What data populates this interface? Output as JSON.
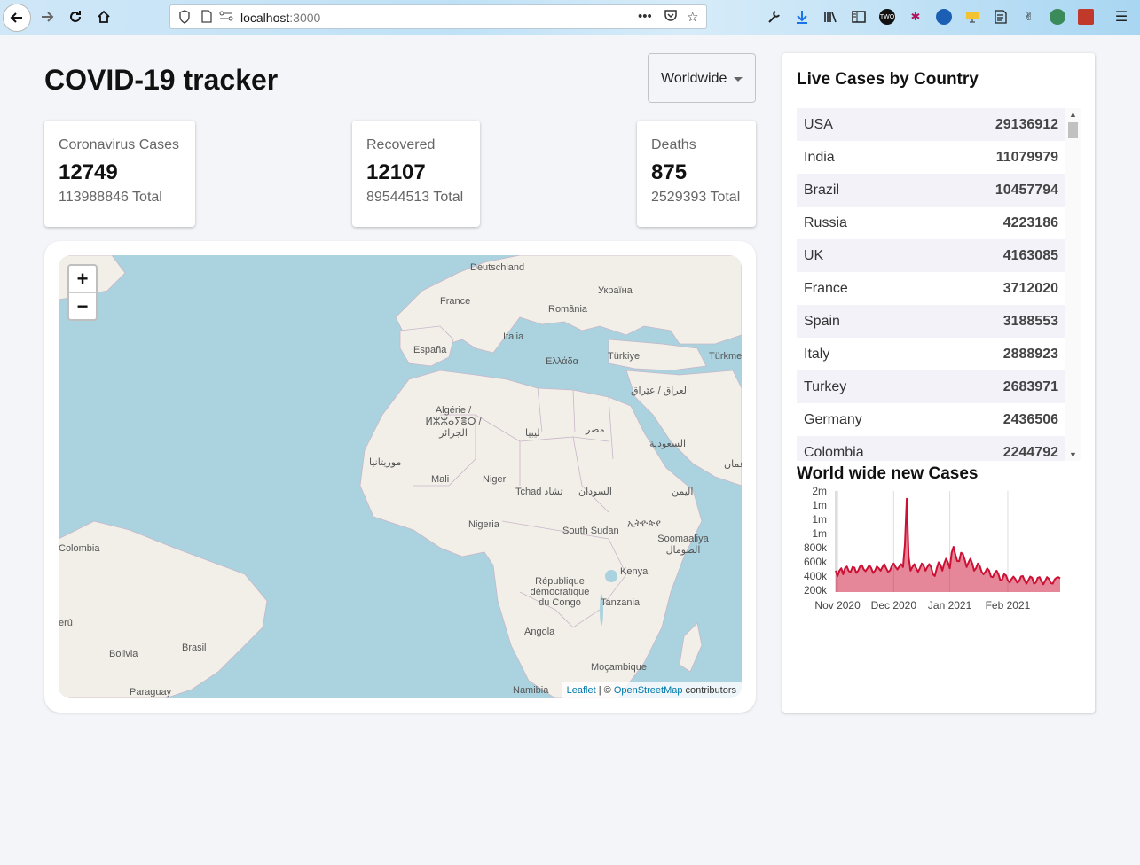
{
  "browser": {
    "url_host": "localhost",
    "url_port": ":3000",
    "extension_badge": "TWO"
  },
  "header": {
    "title": "COVID-19 tracker",
    "country_select": {
      "selected": "Worldwide"
    }
  },
  "stats": {
    "cases": {
      "label": "Coronavirus Cases",
      "today": "12749",
      "total": "113988846 Total"
    },
    "recovered": {
      "label": "Recovered",
      "today": "12107",
      "total": "89544513 Total"
    },
    "deaths": {
      "label": "Deaths",
      "today": "875",
      "total": "2529393 Total"
    }
  },
  "map": {
    "zoom_in": "+",
    "zoom_out": "−",
    "attribution": {
      "leaflet": "Leaflet",
      "sep": " | © ",
      "osm": "OpenStreetMap",
      "suffix": " contributors"
    },
    "labels": [
      "Deutschland",
      "France",
      "Україна",
      "România",
      "Italia",
      "España",
      "Türkiye",
      "Ελλάδα",
      "Türkme",
      "العراق / عێراق",
      "Algérie / ⵍⵣⵣⴰⵢⴻⵔ / الجزائر",
      "ليبيا",
      "مصر",
      "السعودية",
      "موريتانيا",
      "Mali",
      "Niger",
      "Tchad تشاد",
      "السودان",
      "اليمن",
      "Nigeria",
      "South Sudan",
      "ኢትዮጵያ",
      "Soomaaliya الصومال",
      "Kenya",
      "République démocratique du Congo",
      "Tanzania",
      "Angola",
      "Moçambique",
      "Namibia",
      "Colombia",
      "erú",
      "Bolivia",
      "Brasil",
      "Paraguay",
      "عمان"
    ]
  },
  "table": {
    "title": "Live Cases by Country",
    "rows": [
      {
        "country": "USA",
        "cases": "29136912"
      },
      {
        "country": "India",
        "cases": "11079979"
      },
      {
        "country": "Brazil",
        "cases": "10457794"
      },
      {
        "country": "Russia",
        "cases": "4223186"
      },
      {
        "country": "UK",
        "cases": "4163085"
      },
      {
        "country": "France",
        "cases": "3712020"
      },
      {
        "country": "Spain",
        "cases": "3188553"
      },
      {
        "country": "Italy",
        "cases": "2888923"
      },
      {
        "country": "Turkey",
        "cases": "2683971"
      },
      {
        "country": "Germany",
        "cases": "2436506"
      },
      {
        "country": "Colombia",
        "cases": "2244792"
      }
    ]
  },
  "chart_data": {
    "type": "area",
    "title": "World wide new Cases",
    "xlabel": "",
    "ylabel": "",
    "y_tick_labels": [
      "2m",
      "1m",
      "1m",
      "1m",
      "800k",
      "600k",
      "400k",
      "200k"
    ],
    "x_tick_labels": [
      "Nov 2020",
      "Dec 2020",
      "Jan 2021",
      "Feb 2021"
    ],
    "ylim": [
      200000,
      1900000
    ],
    "grid": "vertical",
    "color": "#cc1034",
    "fill": "rgba(204,16,52,0.5)",
    "x": [
      0,
      1,
      2,
      3,
      4,
      5,
      6,
      7,
      8,
      9,
      10,
      11,
      12,
      13,
      14,
      15,
      16,
      17,
      18,
      19,
      20,
      21,
      22,
      23,
      24,
      25,
      26,
      27,
      28,
      29,
      30,
      31,
      32,
      33,
      34,
      35,
      36,
      37,
      38,
      39,
      40,
      41,
      42,
      43,
      44,
      45,
      46,
      47,
      48,
      49,
      50,
      51,
      52,
      53,
      54,
      55,
      56,
      57,
      58,
      59,
      60,
      61,
      62,
      63,
      64,
      65,
      66,
      67,
      68,
      69,
      70,
      71,
      72,
      73,
      74,
      75,
      76,
      77,
      78,
      79,
      80,
      81,
      82,
      83,
      84,
      85,
      86,
      87,
      88,
      89,
      90,
      91,
      92,
      93,
      94,
      95,
      96,
      97,
      98,
      99,
      100,
      101,
      102,
      103,
      104,
      105,
      106,
      107,
      108,
      109,
      110,
      111,
      112,
      113,
      114,
      115,
      116,
      117,
      118,
      119,
      120
    ],
    "values": [
      560000,
      470000,
      560000,
      600000,
      500000,
      600000,
      630000,
      550000,
      540000,
      620000,
      610000,
      520000,
      560000,
      630000,
      650000,
      580000,
      550000,
      600000,
      650000,
      600000,
      520000,
      560000,
      630000,
      600000,
      560000,
      620000,
      670000,
      600000,
      540000,
      560000,
      640000,
      680000,
      620000,
      580000,
      630000,
      670000,
      620000,
      1000000,
      1770000,
      800000,
      560000,
      620000,
      670000,
      600000,
      540000,
      600000,
      680000,
      640000,
      560000,
      620000,
      670000,
      620000,
      500000,
      470000,
      600000,
      700000,
      660000,
      560000,
      680000,
      760000,
      700000,
      600000,
      860000,
      960000,
      830000,
      720000,
      720000,
      860000,
      840000,
      740000,
      620000,
      700000,
      760000,
      680000,
      560000,
      600000,
      680000,
      640000,
      540000,
      500000,
      540000,
      600000,
      560000,
      460000,
      450000,
      520000,
      560000,
      500000,
      400000,
      410000,
      500000,
      480000,
      400000,
      360000,
      420000,
      460000,
      420000,
      360000,
      380000,
      460000,
      470000,
      400000,
      340000,
      400000,
      460000,
      440000,
      340000,
      360000,
      440000,
      450000,
      380000,
      330000,
      390000,
      450000,
      420000,
      350000,
      340000,
      410000,
      440000,
      450000,
      430000
    ],
    "x_tick_positions": [
      1,
      31,
      61,
      92
    ]
  }
}
